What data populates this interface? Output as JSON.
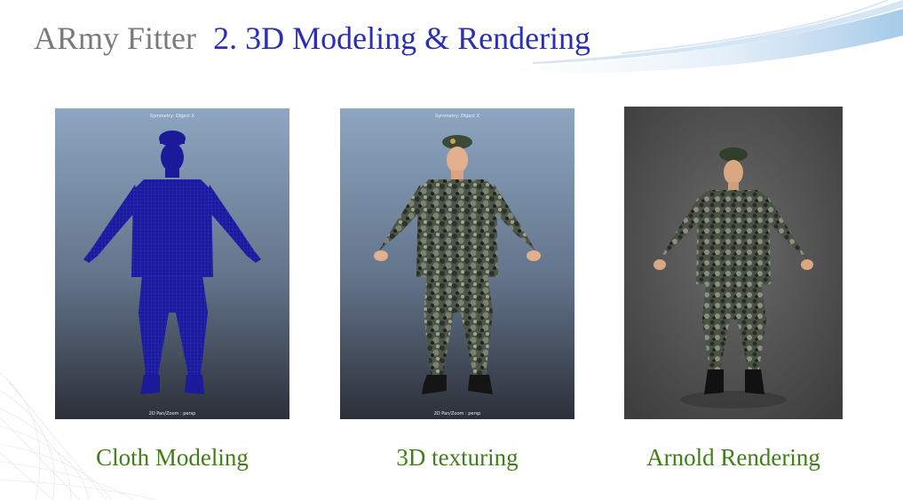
{
  "title": {
    "brand": "ARmy Fitter",
    "section": "2. 3D Modeling & Rendering"
  },
  "colors": {
    "brand": "#7a7a7a",
    "section": "#2a2fb8",
    "caption": "#3f7f16",
    "wireframe": "#1a1a9a",
    "viewport_top": "#8ea6c1",
    "viewport_bottom": "#2c3038",
    "render_bg": "#5b5b5b"
  },
  "panels": [
    {
      "caption": "Cloth Modeling",
      "viewport_top_label": "Symmetry: Object X",
      "viewport_bottom_label": "2D Pan/Zoom : persp"
    },
    {
      "caption": "3D texturing",
      "viewport_top_label": "Symmetry: Object X",
      "viewport_bottom_label": "2D Pan/Zoom : persp"
    },
    {
      "caption": "Arnold Rendering"
    }
  ]
}
